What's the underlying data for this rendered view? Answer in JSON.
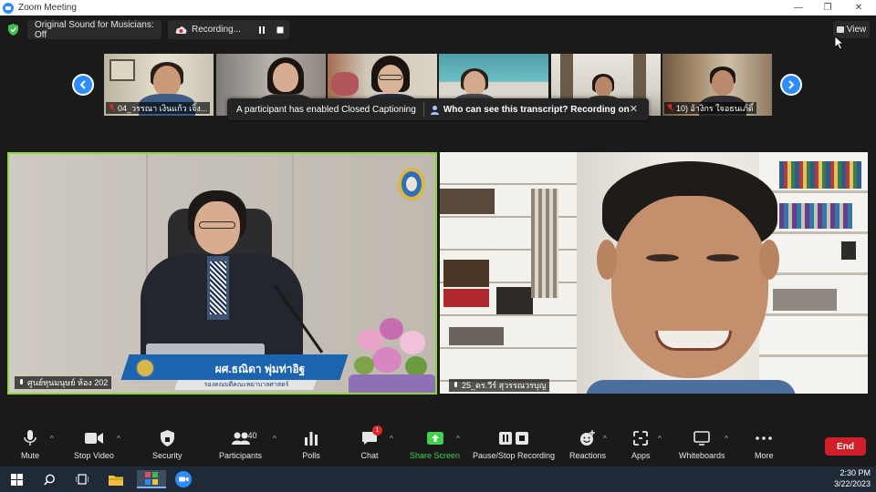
{
  "window": {
    "title": "Zoom Meeting",
    "controls": {
      "minimize": "—",
      "restore": "❐",
      "close": "✕"
    }
  },
  "topbar": {
    "sound_label": "Original Sound for Musicians: Off",
    "recording_label": "Recording...",
    "view_label": "View"
  },
  "thumbnails": [
    {
      "label": "04_วรรณา  เงินแก้ว เจิ้ง..."
    },
    {
      "label": ""
    },
    {
      "label": ""
    },
    {
      "label": ""
    },
    {
      "label": ""
    },
    {
      "label": "10) อ้างิกร  ใจอธนเภ์ดิ์"
    }
  ],
  "toast": {
    "message": "A participant has enabled Closed Captioning",
    "question": "Who can see this transcript? Recording on",
    "close": "✕"
  },
  "main": {
    "left_label": "ศูนย์ทุนมนุษย์ ห้อง 202",
    "right_label": "25_ดร.วีร์ สุวรรณวรบุญ",
    "banner_name": "ผศ.ธณิดา พุ่มท่าอิฐ",
    "banner_subtitle": "รองคณบดีคณะพยาบาลศาสตร์"
  },
  "toolbar": {
    "mute": "Mute",
    "stop_video": "Stop Video",
    "security": "Security",
    "participants": "Participants",
    "participants_count": "40",
    "polls": "Polls",
    "chat": "Chat",
    "chat_badge": "1",
    "share_screen": "Share Screen",
    "pause_recording": "Pause/Stop Recording",
    "reactions": "Reactions",
    "apps": "Apps",
    "whiteboards": "Whiteboards",
    "more": "More",
    "end": "End"
  },
  "taskbar": {
    "time": "2:30 PM",
    "date": "3/22/2023"
  },
  "colors": {
    "zoom_blue": "#2d8cff",
    "active_speaker_border": "#8fd43a",
    "share_green": "#3fd14f",
    "end_red": "#d01f2a"
  }
}
